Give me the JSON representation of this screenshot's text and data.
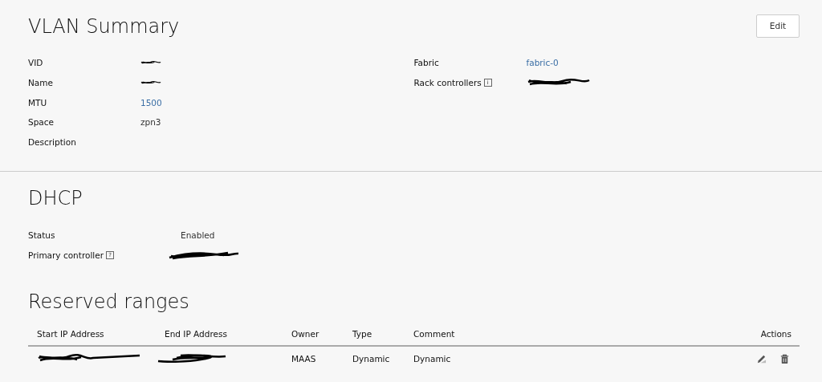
{
  "summary": {
    "title": "VLAN Summary",
    "edit_button": "Edit",
    "left": [
      {
        "label": "VID",
        "redacted": true
      },
      {
        "label": "Name",
        "redacted": true
      },
      {
        "label": "MTU",
        "value": "1500",
        "link": true
      },
      {
        "label": "Space",
        "value": "zpn3"
      },
      {
        "label": "Description"
      }
    ],
    "right": [
      {
        "label": "Fabric",
        "value": "fabric-0",
        "link": true
      },
      {
        "label": "Rack controllers",
        "redacted": true,
        "hint": "i"
      }
    ]
  },
  "dhcp": {
    "title": "DHCP",
    "rows": [
      {
        "label": "Status",
        "value": "Enabled"
      },
      {
        "label": "Primary controller",
        "redacted": true,
        "hint": "?"
      }
    ]
  },
  "reserved": {
    "title": "Reserved ranges",
    "columns": [
      "Start IP Address",
      "End IP Address",
      "Owner",
      "Type",
      "Comment",
      "Actions"
    ],
    "rows": [
      {
        "start_redacted": true,
        "end_redacted": true,
        "owner": "MAAS",
        "type": "Dynamic",
        "comment": "Dynamic"
      }
    ]
  }
}
